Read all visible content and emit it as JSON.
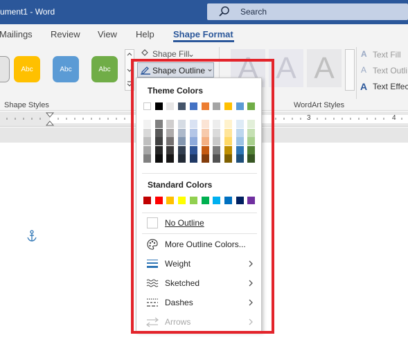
{
  "window": {
    "title": "ument1 - Word"
  },
  "search": {
    "label": "Search"
  },
  "tabs": [
    {
      "id": "mailings",
      "label": "Mailings"
    },
    {
      "id": "review",
      "label": "Review"
    },
    {
      "id": "view",
      "label": "View"
    },
    {
      "id": "help",
      "label": "Help"
    },
    {
      "id": "shape-format",
      "label": "Shape Format",
      "active": true
    }
  ],
  "ribbon": {
    "shape_styles_label": "Shape Styles",
    "wordart_styles_label": "WordArt Styles",
    "style_buttons": [
      {
        "label": "Abc",
        "color": "#ffc000"
      },
      {
        "label": "Abc",
        "color": "#5b9bd5"
      },
      {
        "label": "Abc",
        "color": "#70ad47"
      }
    ],
    "shape_fill": "Shape Fill",
    "shape_outline": "Shape Outline",
    "text_fill": "Text Fill",
    "text_outline": "Text Outli",
    "text_effects": "Text Effec",
    "wordart_letter": "A"
  },
  "ruler": {
    "n3": "3",
    "n4": "4"
  },
  "dropdown": {
    "theme_colors_label": "Theme Colors",
    "standard_colors_label": "Standard Colors",
    "theme_row": [
      "#ffffff",
      "#000000",
      "#e7e6e6",
      "#44546a",
      "#4472c4",
      "#ed7d31",
      "#a5a5a5",
      "#ffc000",
      "#5b9bd5",
      "#70ad47"
    ],
    "theme_shades": [
      [
        "#f2f2f2",
        "#d9d9d9",
        "#bfbfbf",
        "#a6a6a6",
        "#808080"
      ],
      [
        "#808080",
        "#595959",
        "#404040",
        "#262626",
        "#0d0d0d"
      ],
      [
        "#d0cece",
        "#aeabab",
        "#757171",
        "#3a3838",
        "#171616"
      ],
      [
        "#d6dce4",
        "#adb9ca",
        "#8497b0",
        "#333f50",
        "#222a35"
      ],
      [
        "#d9e2f3",
        "#b4c6e7",
        "#8eaadb",
        "#2f5496",
        "#1f3864"
      ],
      [
        "#fbe4d5",
        "#f7caac",
        "#f4b083",
        "#c55a11",
        "#833c0b"
      ],
      [
        "#ededed",
        "#dbdbdb",
        "#c9c9c9",
        "#7b7b7b",
        "#525252"
      ],
      [
        "#fff2cc",
        "#ffe599",
        "#ffd966",
        "#bf8f00",
        "#7f6000"
      ],
      [
        "#deebf6",
        "#bdd7ee",
        "#9cc3e5",
        "#2e75b5",
        "#1e4e79"
      ],
      [
        "#e2efd9",
        "#c5e0b3",
        "#a8d08d",
        "#538135",
        "#375623"
      ]
    ],
    "standard_colors": [
      "#c00000",
      "#ff0000",
      "#ffc000",
      "#ffff00",
      "#92d050",
      "#00b050",
      "#00b0f0",
      "#0070c0",
      "#002060",
      "#7030a0"
    ],
    "items": {
      "no_outline": "No Outline",
      "more_colors": "More Outline Colors...",
      "weight": "Weight",
      "sketched": "Sketched",
      "dashes": "Dashes",
      "arrows": "Arrows"
    }
  },
  "colors": {
    "accent": "#2b579a",
    "highlight": "#e3242b"
  }
}
